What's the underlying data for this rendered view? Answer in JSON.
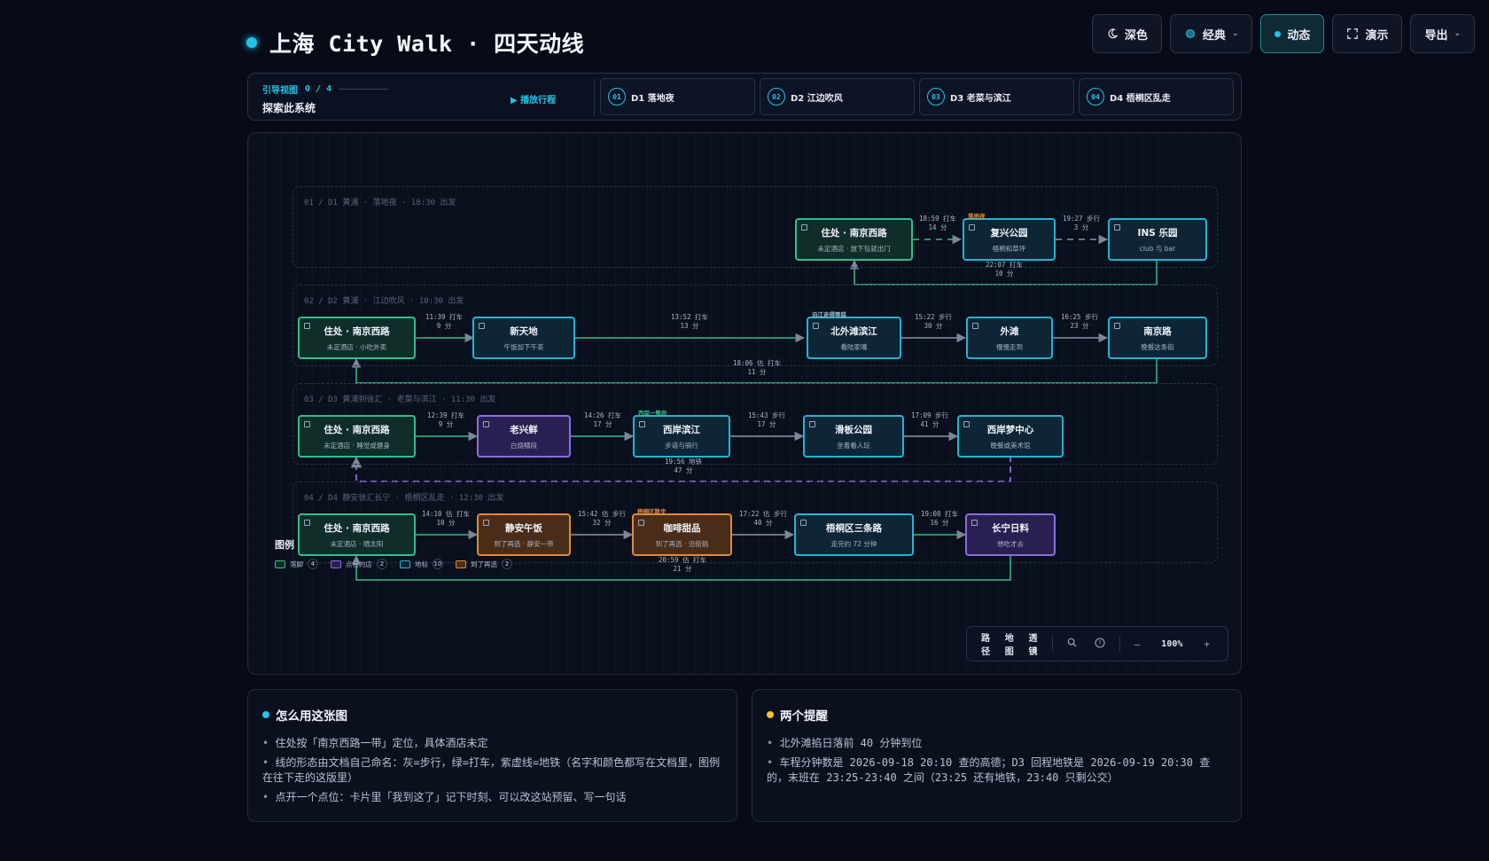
{
  "header": {
    "title": "上海 City Walk · 四天动线",
    "toolbar": [
      {
        "label": "深色",
        "icon": "moon-icon"
      },
      {
        "label": "经典",
        "icon": "palette-icon",
        "dropdown": true
      },
      {
        "label": "动态",
        "icon": "live-dot",
        "active": true
      },
      {
        "label": "演示",
        "icon": "expand-icon"
      },
      {
        "label": "导出",
        "icon": "",
        "dropdown": true
      }
    ]
  },
  "guide": {
    "kicker": "引导视图",
    "progress": "0 / 4",
    "subtitle": "探索此系统",
    "play": "▶ 播放行程",
    "tabs": [
      {
        "num": "01",
        "label": "D1 落地夜"
      },
      {
        "num": "02",
        "label": "D2 江边吹风"
      },
      {
        "num": "03",
        "label": "D3 老菜与滨江"
      },
      {
        "num": "04",
        "label": "D4 梧桐区乱走"
      }
    ]
  },
  "lanes": [
    {
      "title": "01 / D1 黄浦 · 落地夜 · 18:30 出发"
    },
    {
      "title": "02 / D2 黄浦 · 江边吹风 · 10:30 出发"
    },
    {
      "title": "03 / D3 黄浦到徐汇 · 老菜与滨江 · 11:30 出发"
    },
    {
      "title": "04 / D4 静安徐汇长宁 · 梧桐区乱走 · 12:30 出发"
    }
  ],
  "nodes": {
    "d1_home": {
      "title": "住处 · 南京西路",
      "sub": "未定酒店 · 放下包就出门"
    },
    "d1_fuxing": {
      "title": "复兴公园",
      "sub": "梧桐和草坪",
      "tag": "落地夜"
    },
    "d1_ins": {
      "title": "INS 乐园",
      "sub": "club 与 bar"
    },
    "d2_home": {
      "title": "住处 · 南京西路",
      "sub": "未定酒店 · 小吃外卖"
    },
    "d2_xintiandi": {
      "title": "新天地",
      "sub": "午饭加下午茶"
    },
    "d2_north_bund": {
      "title": "北外滩滨江",
      "sub": "看陆家嘴",
      "tag": "沿江走得等底"
    },
    "d2_bund": {
      "title": "外滩",
      "sub": "慢慢走到"
    },
    "d2_nanjing": {
      "title": "南京路",
      "sub": "晚餐这条街"
    },
    "d3_home": {
      "title": "住处 · 南京西路",
      "sub": "未定酒店 · 睡觉或健身"
    },
    "d3_laoxing": {
      "title": "老兴鲜",
      "sub": "白烧鳝段"
    },
    "d3_west_bund": {
      "title": "西岸滨江",
      "sub": "步道与骑行",
      "tag": "西岸一整段"
    },
    "d3_skate": {
      "title": "滑板公园",
      "sub": "坐着看人玩"
    },
    "d3_dream": {
      "title": "西岸梦中心",
      "sub": "晚餐或美术馆"
    },
    "d4_home": {
      "title": "住处 · 南京西路",
      "sub": "未定酒店 · 晒太阳"
    },
    "d4_lunch": {
      "title": "静安午饭",
      "sub": "到了再选 · 静安一带"
    },
    "d4_coffee": {
      "title": "咖啡甜品",
      "sub": "到了再选 · 沿街挑",
      "tag": "梧桐区散步"
    },
    "d4_wutong": {
      "title": "梧桐区三条路",
      "sub": "走完约 72 分钟"
    },
    "d4_changning": {
      "title": "长宁日料",
      "sub": "想吃才去"
    }
  },
  "edges": [
    {
      "id": "e1",
      "l1": "18:59 打车",
      "l2": "14 分"
    },
    {
      "id": "e2",
      "l1": "19:27 步行",
      "l2": "3 分"
    },
    {
      "id": "e3",
      "l1": "22:07 打车",
      "l2": "10 分"
    },
    {
      "id": "e4",
      "l1": "11:39 打车",
      "l2": "9 分"
    },
    {
      "id": "e5",
      "l1": "13:52 打车",
      "l2": "13 分"
    },
    {
      "id": "e6",
      "l1": "15:22 步行",
      "l2": "30 分"
    },
    {
      "id": "e7",
      "l1": "16:25 步行",
      "l2": "23 分"
    },
    {
      "id": "e8",
      "l1": "18:06 估 打车",
      "l2": "11 分"
    },
    {
      "id": "e9",
      "l1": "12:39 打车",
      "l2": "9 分"
    },
    {
      "id": "e10",
      "l1": "14:26 打车",
      "l2": "17 分"
    },
    {
      "id": "e11",
      "l1": "15:43 步行",
      "l2": "17 分"
    },
    {
      "id": "e12",
      "l1": "17:09 步行",
      "l2": "41 分"
    },
    {
      "id": "e13",
      "l1": "19:56 地铁",
      "l2": "47 分"
    },
    {
      "id": "e14",
      "l1": "14:10 估 打车",
      "l2": "10 分"
    },
    {
      "id": "e15",
      "l1": "15:42 估 步行",
      "l2": "32 分"
    },
    {
      "id": "e16",
      "l1": "17:22 估 步行",
      "l2": "40 分"
    },
    {
      "id": "e17",
      "l1": "19:08 打车",
      "l2": "16 分"
    },
    {
      "id": "e18",
      "l1": "20:59 估 打车",
      "l2": "21 分"
    }
  ],
  "legend": {
    "title": "图例",
    "items": [
      {
        "label": "落脚",
        "count": "4",
        "color": "#2fbf8a"
      },
      {
        "label": "点名的店",
        "count": "2",
        "color": "#8a6ee0"
      },
      {
        "label": "地标",
        "count": "10",
        "color": "#22b4d6"
      },
      {
        "label": "到了再选",
        "count": "2",
        "color": "#e08a3c"
      }
    ]
  },
  "view_controls": {
    "modes": [
      "路径",
      "地图",
      "透镜"
    ],
    "zoom_out": "—",
    "zoom": "100%",
    "zoom_in": "+"
  },
  "cards": {
    "howto": {
      "title": "怎么用这张图",
      "items": [
        "住处按「南京西路一带」定位，具体酒店未定",
        "线的形态由文档自己命名：灰=步行，绿=打车，紫虚线=地铁（名字和颜色都写在文档里，图例在往下走的这版里）",
        "点开一个点位：卡片里「我到这了」记下时刻、可以改这站预留、写一句话"
      ]
    },
    "reminders": {
      "title": "两个提醒",
      "items": [
        "北外滩掐日落前 40 分钟到位",
        "车程分钟数是 2026-09-18 20:10 查的高德；D3 回程地铁是 2026-09-19 20:30 查的，末班在 23:25-23:40 之间（23:25 还有地铁，23:40 只剩公交）"
      ]
    }
  },
  "colors": {
    "accent": "#22c3e6",
    "walk": "#8d96a8",
    "taxi": "#2fbf8a",
    "metro": "#8a6ee0",
    "home": "#2fbf8a",
    "landmark": "#22b4d6",
    "named": "#8a6ee0",
    "arrive": "#e08a3c",
    "reminder": "#f2c230"
  }
}
